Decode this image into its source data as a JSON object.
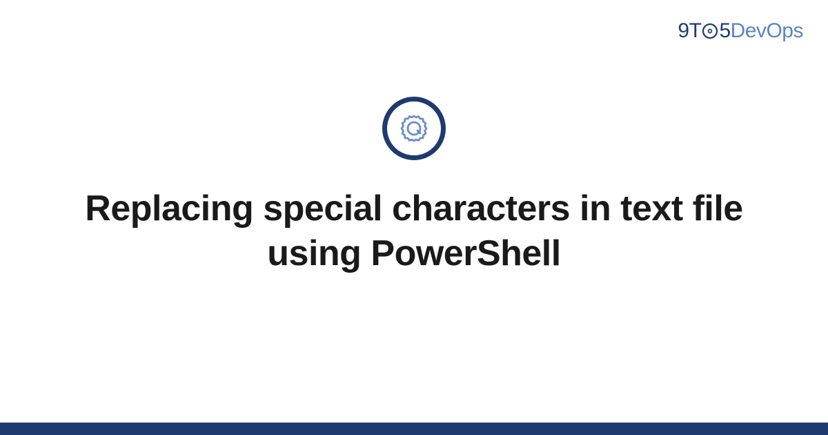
{
  "brand": {
    "part1": "9T",
    "part2": "5",
    "part3": "DevOps"
  },
  "title": "Replacing special characters in text file using PowerShell",
  "colors": {
    "primary": "#1e3a6e",
    "accent": "#5b84c4"
  }
}
